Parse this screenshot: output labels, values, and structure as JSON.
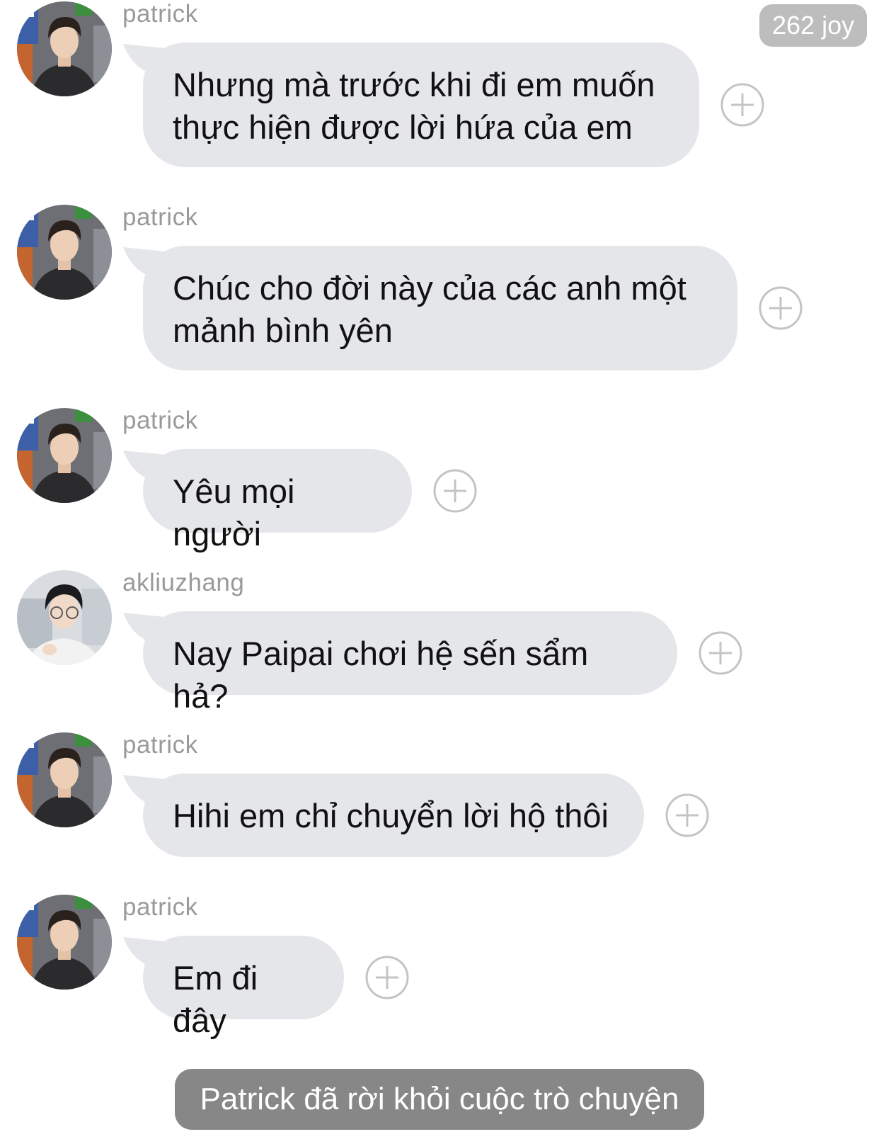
{
  "header": {
    "badge_label": "262 joy"
  },
  "messages": [
    {
      "sender": "patrick",
      "avatar": "patrick-avatar",
      "text": "Nhưng mà trước khi đi em muốn thực hiện được lời hứa của em"
    },
    {
      "sender": "patrick",
      "avatar": "patrick-avatar",
      "text": "Chúc cho đời này của các anh một mảnh bình yên"
    },
    {
      "sender": "patrick",
      "avatar": "patrick-avatar",
      "text": "Yêu mọi người"
    },
    {
      "sender": "akliuzhang",
      "avatar": "akliuzhang-avatar",
      "text": "Nay Paipai chơi hệ sến sẩm hả?"
    },
    {
      "sender": "patrick",
      "avatar": "patrick-avatar",
      "text": "Hihi em chỉ chuyển lời hộ thôi"
    },
    {
      "sender": "patrick",
      "avatar": "patrick-avatar",
      "text": "Em đi đây"
    }
  ],
  "system_notice": "Patrick đã rời khỏi cuộc trò chuyện",
  "colors": {
    "bubble": "#e5e6ea",
    "sender_name": "#9a9a9a",
    "badge": "#bdbdbd",
    "system_notice": "#878787",
    "react_icon": "#c4c4c4"
  },
  "icons": {
    "react": "plus-circle-icon"
  }
}
